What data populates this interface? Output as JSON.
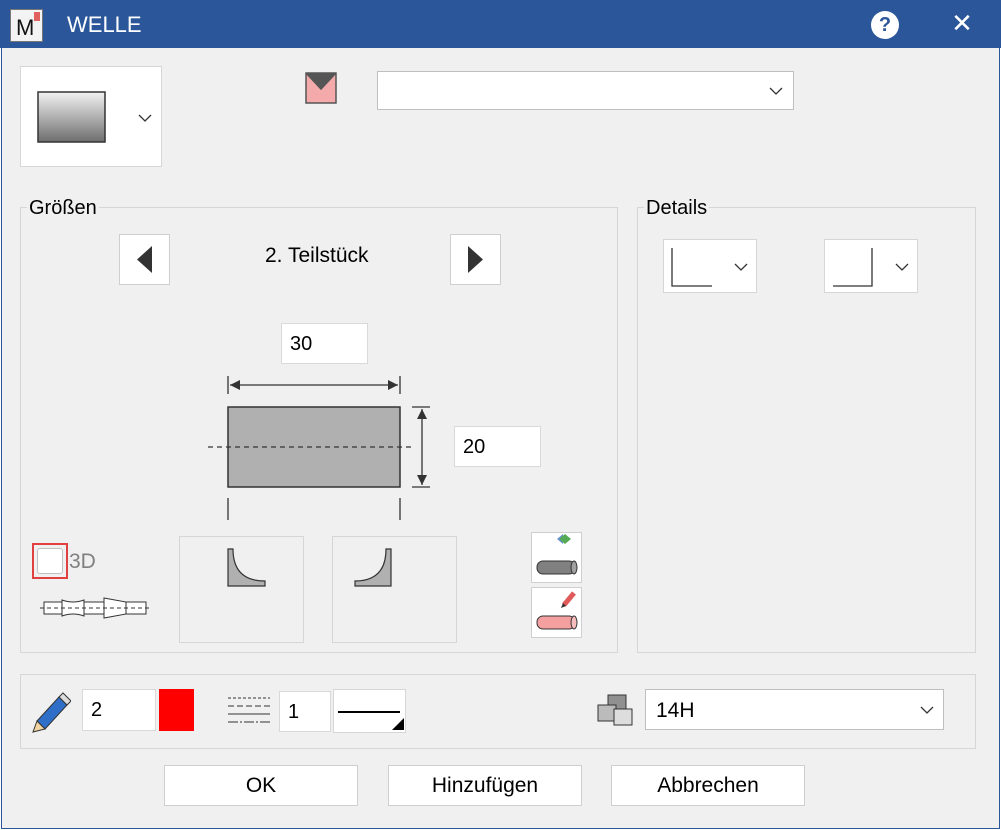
{
  "window": {
    "title": "WELLE",
    "help_label": "?",
    "close_label": "✕"
  },
  "top": {
    "shape_selector": {
      "icon": "gradient-rectangle-icon"
    },
    "color_icon": "envelope-color-icon",
    "dropdown_value": ""
  },
  "groessen": {
    "label": "Größen",
    "section_name": "2. Teilstück",
    "width_value": "30",
    "height_value": "20",
    "checkbox_3d_label": "3D",
    "checkbox_3d_checked": false
  },
  "details": {
    "label": "Details"
  },
  "bottom": {
    "pen_value": "2",
    "pen_color": "#ff0000",
    "linetype_value": "1",
    "tolerance_value": "14H"
  },
  "buttons": {
    "ok": "OK",
    "add": "Hinzufügen",
    "cancel": "Abbrechen"
  }
}
